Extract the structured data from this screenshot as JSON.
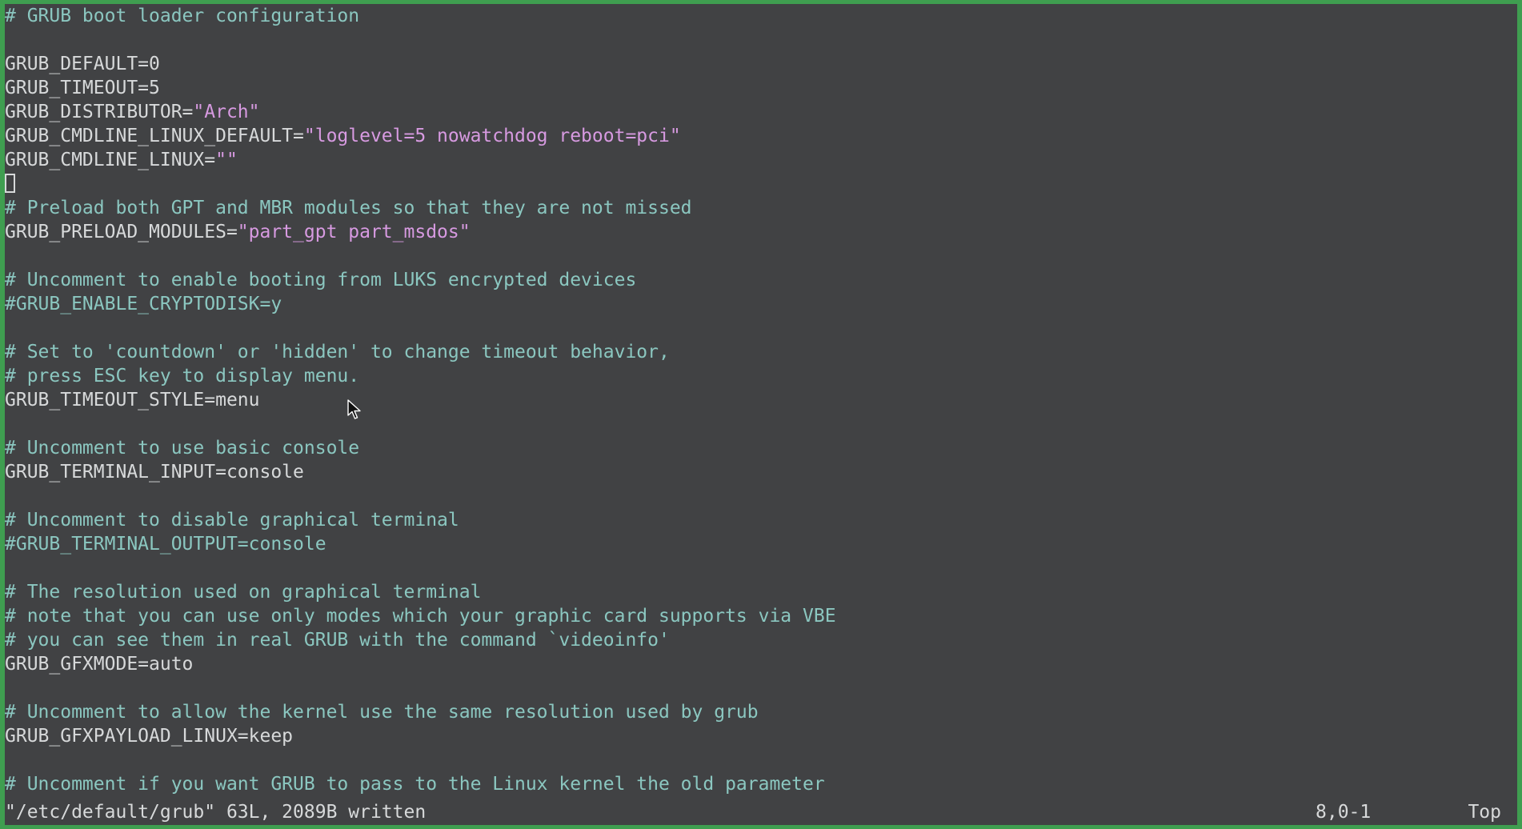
{
  "editor": {
    "lines": [
      {
        "parts": [
          {
            "t": "# GRUB boot loader configuration",
            "c": "comment"
          }
        ]
      },
      {
        "parts": []
      },
      {
        "parts": [
          {
            "t": "GRUB_DEFAULT=0",
            "c": "plain"
          }
        ]
      },
      {
        "parts": [
          {
            "t": "GRUB_TIMEOUT=5",
            "c": "plain"
          }
        ]
      },
      {
        "parts": [
          {
            "t": "GRUB_DISTRIBUTOR=",
            "c": "plain"
          },
          {
            "t": "\"Arch\"",
            "c": "string"
          }
        ]
      },
      {
        "parts": [
          {
            "t": "GRUB_CMDLINE_LINUX_DEFAULT=",
            "c": "plain"
          },
          {
            "t": "\"loglevel=5 nowatchdog reboot=pci\"",
            "c": "string"
          }
        ]
      },
      {
        "parts": [
          {
            "t": "GRUB_CMDLINE_LINUX=",
            "c": "plain"
          },
          {
            "t": "\"\"",
            "c": "string"
          }
        ]
      },
      {
        "parts": [],
        "cursor": true
      },
      {
        "parts": [
          {
            "t": "# Preload both GPT and MBR modules so that they are not missed",
            "c": "comment"
          }
        ]
      },
      {
        "parts": [
          {
            "t": "GRUB_PRELOAD_MODULES=",
            "c": "plain"
          },
          {
            "t": "\"part_gpt part_msdos\"",
            "c": "string"
          }
        ]
      },
      {
        "parts": []
      },
      {
        "parts": [
          {
            "t": "# Uncomment to enable booting from LUKS encrypted devices",
            "c": "comment"
          }
        ]
      },
      {
        "parts": [
          {
            "t": "#GRUB_ENABLE_CRYPTODISK=y",
            "c": "cmt-code"
          }
        ]
      },
      {
        "parts": []
      },
      {
        "parts": [
          {
            "t": "# Set to 'countdown' or 'hidden' to change timeout behavior,",
            "c": "comment"
          }
        ]
      },
      {
        "parts": [
          {
            "t": "# press ESC key to display menu.",
            "c": "comment"
          }
        ]
      },
      {
        "parts": [
          {
            "t": "GRUB_TIMEOUT_STYLE=menu",
            "c": "plain"
          }
        ]
      },
      {
        "parts": []
      },
      {
        "parts": [
          {
            "t": "# Uncomment to use basic console",
            "c": "comment"
          }
        ]
      },
      {
        "parts": [
          {
            "t": "GRUB_TERMINAL_INPUT=console",
            "c": "plain"
          }
        ]
      },
      {
        "parts": []
      },
      {
        "parts": [
          {
            "t": "# Uncomment to disable graphical terminal",
            "c": "comment"
          }
        ]
      },
      {
        "parts": [
          {
            "t": "#GRUB_TERMINAL_OUTPUT=console",
            "c": "cmt-code"
          }
        ]
      },
      {
        "parts": []
      },
      {
        "parts": [
          {
            "t": "# The resolution used on graphical terminal",
            "c": "comment"
          }
        ]
      },
      {
        "parts": [
          {
            "t": "# note that you can use only modes which your graphic card supports via VBE",
            "c": "comment"
          }
        ]
      },
      {
        "parts": [
          {
            "t": "# you can see them in real GRUB with the command `videoinfo'",
            "c": "comment"
          }
        ]
      },
      {
        "parts": [
          {
            "t": "GRUB_GFXMODE=auto",
            "c": "plain"
          }
        ]
      },
      {
        "parts": []
      },
      {
        "parts": [
          {
            "t": "# Uncomment to allow the kernel use the same resolution used by grub",
            "c": "comment"
          }
        ]
      },
      {
        "parts": [
          {
            "t": "GRUB_GFXPAYLOAD_LINUX=keep",
            "c": "plain"
          }
        ]
      },
      {
        "parts": []
      },
      {
        "parts": [
          {
            "t": "# Uncomment if you want GRUB to pass to the Linux kernel the old parameter",
            "c": "comment"
          }
        ]
      }
    ]
  },
  "status": {
    "message": "\"/etc/default/grub\" 63L, 2089B written",
    "position": "8,0-1",
    "scroll": "Top"
  },
  "colors": {
    "background": "#414244",
    "frame": "#3f9e50",
    "text": "#d7d9da",
    "comment": "#8bc7c0",
    "string": "#d79ae1"
  },
  "icons": {
    "cursor": "text-cursor-icon",
    "pointer": "mouse-pointer-icon"
  }
}
